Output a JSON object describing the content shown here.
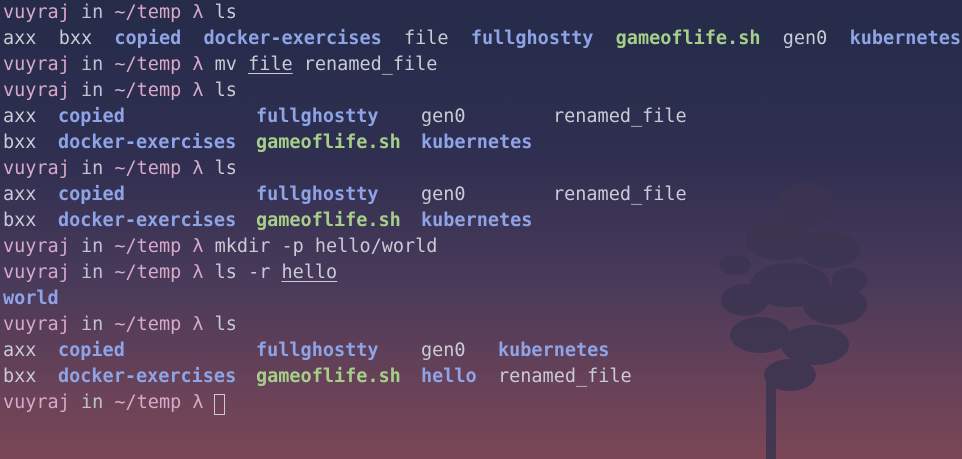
{
  "colors": {
    "prompt": "#d9a9c9",
    "text": "#c9cbd6",
    "directory": "#8ea4e6",
    "executable": "#a6cf8a"
  },
  "prompt": {
    "user": "vuyraj",
    "in": "in",
    "path": "~/temp",
    "lambda": "λ"
  },
  "lines": [
    {
      "type": "prompt",
      "cmd": "ls"
    },
    {
      "type": "output",
      "items": [
        {
          "text": "axx",
          "kind": "file"
        },
        {
          "text": "bxx",
          "kind": "file"
        },
        {
          "text": "copied",
          "kind": "dir"
        },
        {
          "text": "docker-exercises",
          "kind": "dir"
        },
        {
          "text": "file",
          "kind": "file"
        },
        {
          "text": "fullghostty",
          "kind": "dir"
        },
        {
          "text": "gameoflife.sh",
          "kind": "exec"
        },
        {
          "text": "gen0",
          "kind": "file"
        },
        {
          "text": "kubernetes",
          "kind": "dir"
        }
      ]
    },
    {
      "type": "prompt",
      "cmd": "mv",
      "args": [
        {
          "text": "file",
          "underline": true
        },
        {
          "text": "renamed_file",
          "underline": false
        }
      ]
    },
    {
      "type": "prompt",
      "cmd": "ls"
    },
    {
      "type": "output",
      "items": [
        {
          "text": "axx",
          "kind": "file"
        },
        {
          "text": "copied",
          "kind": "dir"
        },
        {
          "text": "fullghostty",
          "kind": "dir"
        },
        {
          "text": "gen0",
          "kind": "file"
        },
        {
          "text": "renamed_file",
          "kind": "file"
        }
      ]
    },
    {
      "type": "output",
      "items": [
        {
          "text": "bxx",
          "kind": "file"
        },
        {
          "text": "docker-exercises",
          "kind": "dir"
        },
        {
          "text": "gameoflife.sh",
          "kind": "exec"
        },
        {
          "text": "kubernetes",
          "kind": "dir"
        }
      ]
    },
    {
      "type": "prompt",
      "cmd": "ls"
    },
    {
      "type": "output",
      "items": [
        {
          "text": "axx",
          "kind": "file"
        },
        {
          "text": "copied",
          "kind": "dir"
        },
        {
          "text": "fullghostty",
          "kind": "dir"
        },
        {
          "text": "gen0",
          "kind": "file"
        },
        {
          "text": "renamed_file",
          "kind": "file"
        }
      ]
    },
    {
      "type": "output",
      "items": [
        {
          "text": "bxx",
          "kind": "file"
        },
        {
          "text": "docker-exercises",
          "kind": "dir"
        },
        {
          "text": "gameoflife.sh",
          "kind": "exec"
        },
        {
          "text": "kubernetes",
          "kind": "dir"
        }
      ]
    },
    {
      "type": "prompt",
      "cmd": "mkdir",
      "args": [
        {
          "text": "-p",
          "underline": false
        },
        {
          "text": "hello/world",
          "underline": false
        }
      ]
    },
    {
      "type": "prompt",
      "cmd": "ls",
      "args": [
        {
          "text": "-r",
          "underline": false
        },
        {
          "text": "hello",
          "underline": true
        }
      ]
    },
    {
      "type": "output",
      "items": [
        {
          "text": "world",
          "kind": "dir"
        }
      ]
    },
    {
      "type": "prompt",
      "cmd": "ls"
    },
    {
      "type": "output",
      "items": [
        {
          "text": "axx",
          "kind": "file"
        },
        {
          "text": "copied",
          "kind": "dir"
        },
        {
          "text": "fullghostty",
          "kind": "dir"
        },
        {
          "text": "gen0",
          "kind": "file"
        },
        {
          "text": "kubernetes",
          "kind": "dir"
        }
      ]
    },
    {
      "type": "output",
      "items": [
        {
          "text": "bxx",
          "kind": "file"
        },
        {
          "text": "docker-exercises",
          "kind": "dir"
        },
        {
          "text": "gameoflife.sh",
          "kind": "exec"
        },
        {
          "text": "hello",
          "kind": "dir"
        },
        {
          "text": "renamed_file",
          "kind": "file"
        }
      ]
    },
    {
      "type": "prompt",
      "cmd": "",
      "cursor": true
    }
  ]
}
